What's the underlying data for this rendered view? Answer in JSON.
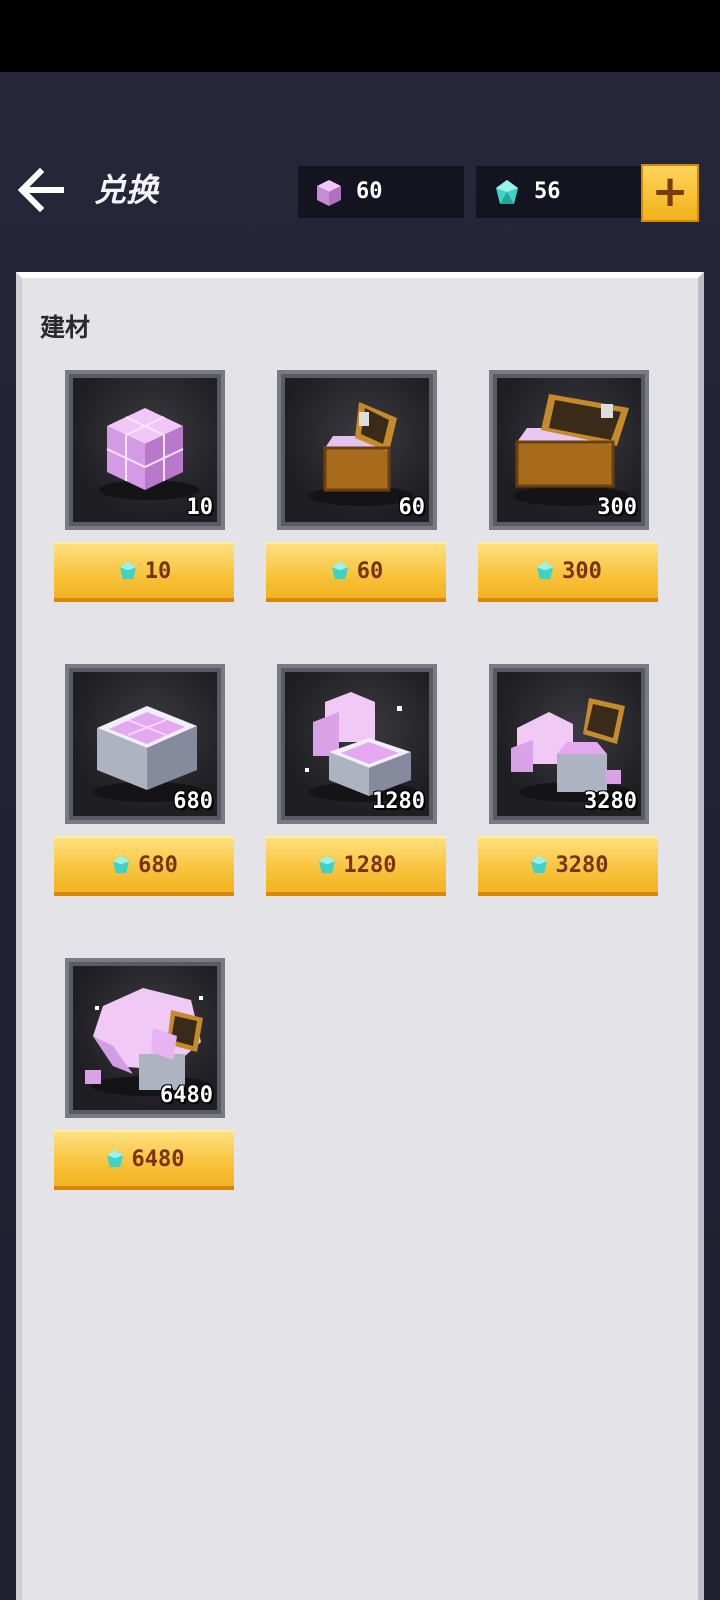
{
  "header": {
    "title": "兑换",
    "cube_balance": "60",
    "diamond_balance": "56"
  },
  "section": {
    "title": "建材"
  },
  "items": [
    {
      "quantity": "10",
      "price": "10"
    },
    {
      "quantity": "60",
      "price": "60"
    },
    {
      "quantity": "300",
      "price": "300"
    },
    {
      "quantity": "680",
      "price": "680"
    },
    {
      "quantity": "1280",
      "price": "1280"
    },
    {
      "quantity": "3280",
      "price": "3280"
    },
    {
      "quantity": "6480",
      "price": "6480"
    }
  ],
  "colors": {
    "accent": "#f8c23a",
    "price_text": "#7a3314",
    "cube": "#e2a6ef",
    "diamond": "#3fd3c7"
  }
}
